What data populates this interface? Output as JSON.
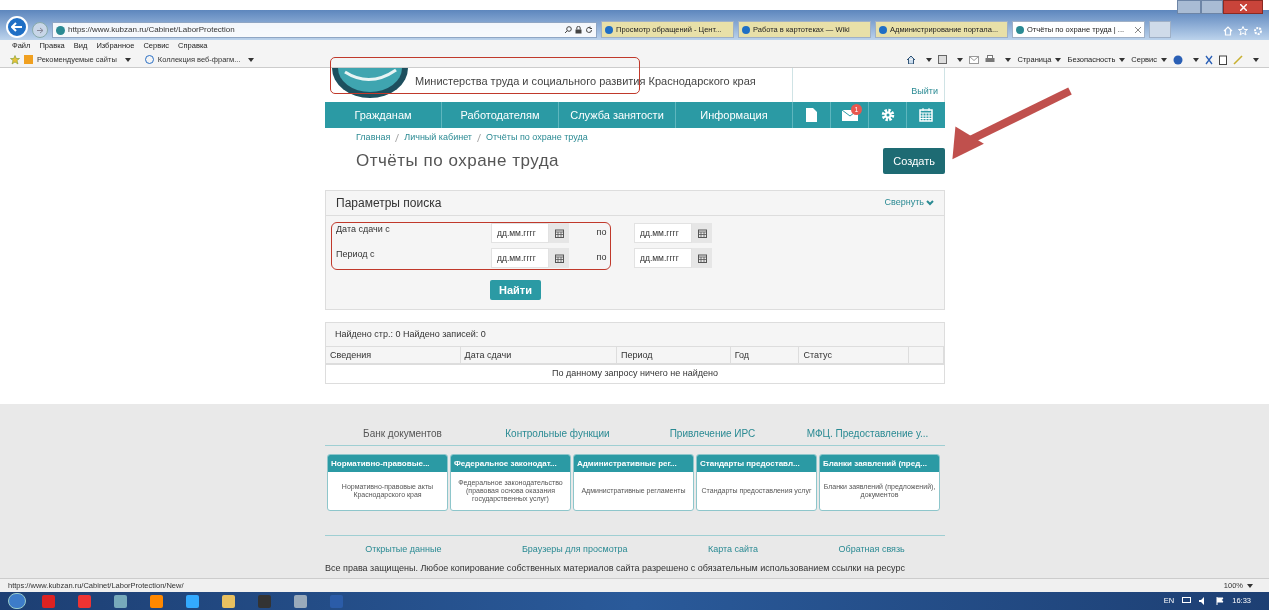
{
  "browser": {
    "address": "https://www.kubzan.ru/Cabinet/LaborProtection",
    "tabs": [
      {
        "title": "Просмотр обращений - Цент...",
        "selected": false
      },
      {
        "title": "Работа в картотеках — Wiki",
        "selected": false
      },
      {
        "title": "Администрирование портала...",
        "selected": false
      },
      {
        "title": "Отчёты по охране труда | ...",
        "selected": true
      }
    ],
    "menu": [
      "Файл",
      "Правка",
      "Вид",
      "Избранное",
      "Сервис",
      "Справка"
    ],
    "favorites": [
      "Рекомендуемые сайты",
      "Коллекция веб-фрагм..."
    ],
    "commands": [
      "Страница",
      "Безопасность",
      "Сервис"
    ]
  },
  "page": {
    "header": {
      "ministry": "Министерства труда и социального развития Краснодарского края",
      "logout": "Выйти"
    },
    "nav": {
      "items": [
        "Гражданам",
        "Работодателям",
        "Служба занятости",
        "Информация"
      ],
      "mail_badge": "1"
    },
    "breadcrumbs": [
      "Главная",
      "Личный кабинет",
      "Отчёты по охране труда"
    ],
    "title": "Отчёты по охране труда",
    "create_button": "Создать",
    "search": {
      "title": "Параметры поиска",
      "collapse": "Свернуть",
      "rows": [
        {
          "label": "Дата сдачи с",
          "from_placeholder": "дд.мм.гггг",
          "to_label": "по",
          "to_placeholder": "дд.мм.гггг"
        },
        {
          "label": "Период с",
          "from_placeholder": "дд.мм.гггг",
          "to_label": "по",
          "to_placeholder": "дд.мм.гггг"
        }
      ],
      "find_button": "Найти"
    },
    "results": {
      "summary": "Найдено стр.: 0 Найдено записей: 0",
      "columns": [
        "Сведения",
        "Дата сдачи",
        "Период",
        "Год",
        "Статус"
      ],
      "empty_message": "По данному запросу ничего не найдено"
    },
    "footer": {
      "tabs": [
        {
          "label": "Банк документов",
          "selected": true
        },
        {
          "label": "Контрольные функции",
          "selected": false
        },
        {
          "label": "Привлечение ИРС",
          "selected": false
        },
        {
          "label": "МФЦ. Предоставление у...",
          "selected": false
        }
      ],
      "cards": [
        {
          "title": "Нормативно-правовые...",
          "body": "Нормативно-правовые акты Краснодарского края"
        },
        {
          "title": "Федеральное законодат...",
          "body": "Федеральное законодательство (правовая основа оказания государственных услуг)"
        },
        {
          "title": "Административные рег...",
          "body": "Административные регламенты"
        },
        {
          "title": "Стандарты предоставл...",
          "body": "Стандарты предоставления услуг"
        },
        {
          "title": "Бланки заявлений (пред...",
          "body": "Бланки заявлений (предложений), документов"
        }
      ],
      "links": [
        "Открытые данные",
        "Браузеры для просмотра",
        "Карта сайта",
        "Обратная связь"
      ],
      "copyright": "Все права защищены. Любое копирование собственных материалов сайта разрешено с обязательным использованием ссылки на ресурс"
    }
  },
  "status_bar": {
    "url": "https://www.kubzan.ru/Cabinet/LaborProtection/New/",
    "zoom": "100%"
  },
  "taskbar": {
    "language": "EN",
    "time": "16:33"
  }
}
